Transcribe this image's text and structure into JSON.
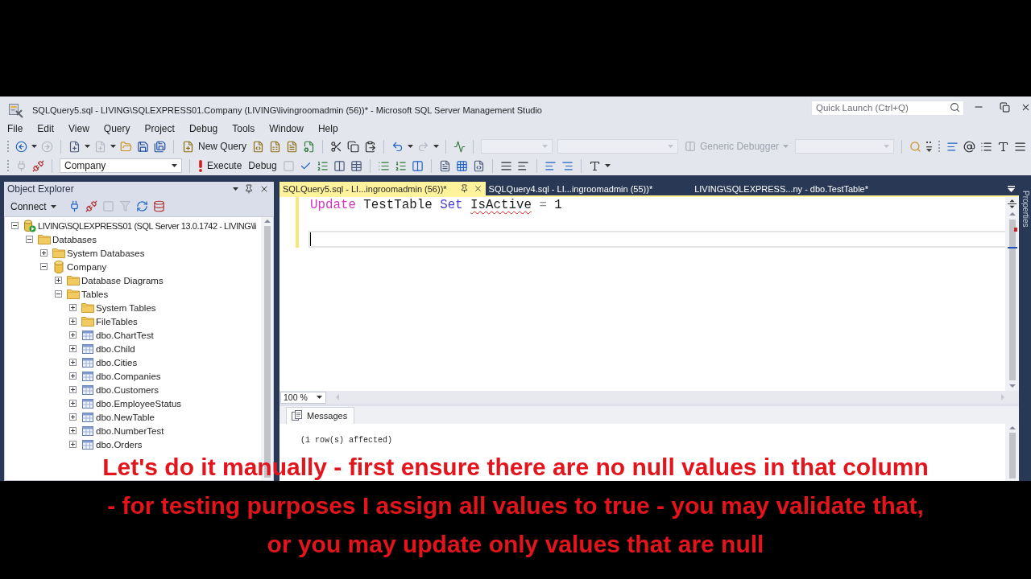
{
  "window": {
    "title": "SQLQuery5.sql - LIVING\\SQLEXPRESS01.Company (LIVING\\livingroomadmin (56))* - Microsoft SQL Server Management Studio",
    "quick_launch": {
      "placeholder": "Quick Launch (Ctrl+Q)"
    }
  },
  "menu": [
    "File",
    "Edit",
    "View",
    "Query",
    "Project",
    "Debug",
    "Tools",
    "Window",
    "Help"
  ],
  "toolbar_1": {
    "new_query": "New Query",
    "debugger_select": {
      "value": "Generic Debugger",
      "disabled": true
    }
  },
  "toolbar_2": {
    "database_select": {
      "value": "Company"
    },
    "execute": "Execute",
    "debug": "Debug"
  },
  "object_explorer": {
    "title": "Object Explorer",
    "connect": "Connect",
    "tree": [
      {
        "label": "LIVING\\SQLEXPRESS01 (SQL Server 13.0.1742 - LIVING\\li",
        "kind": "server",
        "expanded": true,
        "children": [
          {
            "label": "Databases",
            "kind": "folder",
            "expanded": true,
            "children": [
              {
                "label": "System Databases",
                "kind": "folder",
                "expanded": false
              },
              {
                "label": "Company",
                "kind": "database",
                "expanded": true,
                "children": [
                  {
                    "label": "Database Diagrams",
                    "kind": "folder",
                    "expanded": false
                  },
                  {
                    "label": "Tables",
                    "kind": "folder",
                    "expanded": true,
                    "children": [
                      {
                        "label": "System Tables",
                        "kind": "folder",
                        "expanded": false
                      },
                      {
                        "label": "FileTables",
                        "kind": "folder",
                        "expanded": false
                      },
                      {
                        "label": "dbo.ChartTest",
                        "kind": "table",
                        "expanded": false
                      },
                      {
                        "label": "dbo.Child",
                        "kind": "table",
                        "expanded": false
                      },
                      {
                        "label": "dbo.Cities",
                        "kind": "table",
                        "expanded": false
                      },
                      {
                        "label": "dbo.Companies",
                        "kind": "table",
                        "expanded": false
                      },
                      {
                        "label": "dbo.Customers",
                        "kind": "table",
                        "expanded": false
                      },
                      {
                        "label": "dbo.EmployeeStatus",
                        "kind": "table",
                        "expanded": false
                      },
                      {
                        "label": "dbo.NewTable",
                        "kind": "table",
                        "expanded": false
                      },
                      {
                        "label": "dbo.NumberTest",
                        "kind": "table",
                        "expanded": false
                      },
                      {
                        "label": "dbo.Orders",
                        "kind": "table",
                        "expanded": false
                      }
                    ]
                  }
                ]
              }
            ]
          }
        ]
      }
    ]
  },
  "editor": {
    "tabs": [
      {
        "label": "SQLQuery5.sql - LI...ingroomadmin (56))*",
        "selected": true
      },
      {
        "label": "SQLQuery4.sql - LI...ingroomadmin (55))*",
        "selected": false
      },
      {
        "label": "LIVING\\SQLEXPRESS...ny - dbo.TestTable*",
        "selected": false
      }
    ],
    "lines": [
      {
        "modified": true,
        "current": false,
        "tokens": [
          {
            "text": "Update",
            "kind": "function",
            "error": false
          },
          {
            "text": "TestTable",
            "kind": "identifier",
            "error": false
          },
          {
            "text": "Set",
            "kind": "keyword",
            "error": false
          },
          {
            "text": "IsActive",
            "kind": "identifier",
            "error": true
          },
          {
            "text": "=",
            "kind": "operator",
            "error": false
          },
          {
            "text": "1",
            "kind": "number",
            "error": false
          }
        ]
      },
      {
        "modified": true,
        "current": false
      },
      {
        "modified": true,
        "current": true
      }
    ],
    "zoom": "100 %"
  },
  "results": {
    "tabs": [
      {
        "label": "Messages",
        "selected": true
      }
    ],
    "messages": [
      "(1 row(s) affected)"
    ]
  },
  "side_tabs": [
    "Properties"
  ],
  "subtitles": [
    "Let's do it manually - first ensure there are no null values in that column",
    "- for testing purposes I assign all values to true - you may validate that,",
    "or you may update only values that are null"
  ]
}
